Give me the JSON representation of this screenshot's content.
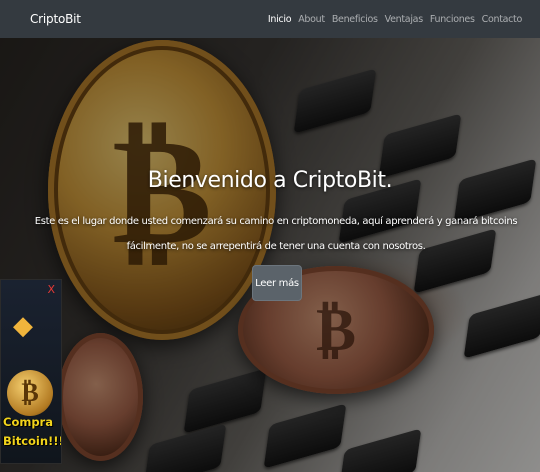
{
  "navbar": {
    "brand": "CriptoBit",
    "links": [
      "Inicio",
      "About",
      "Beneficios",
      "Ventajas",
      "Funciones",
      "Contacto"
    ]
  },
  "hero": {
    "title": "Bienvenido a CriptoBit.",
    "text": "Este es el lugar donde usted comenzará su camino en criptomoneda, aquí aprenderá y ganará bitcoins fácilmente, no se arrepentirá de tener una cuenta con nosotros.",
    "button_label": "Leer más"
  },
  "side_ad": {
    "close_label": "X",
    "line1": "Compra",
    "line2": "Bitcoin!!!"
  },
  "colors": {
    "navbar_bg": "#343a40",
    "button_bg": "#5b636a",
    "ad_text": "#f2d41c",
    "ad_close": "#e53935"
  },
  "icons": [
    "bitcoin-coin",
    "ethereum-icon",
    "close-icon"
  ]
}
